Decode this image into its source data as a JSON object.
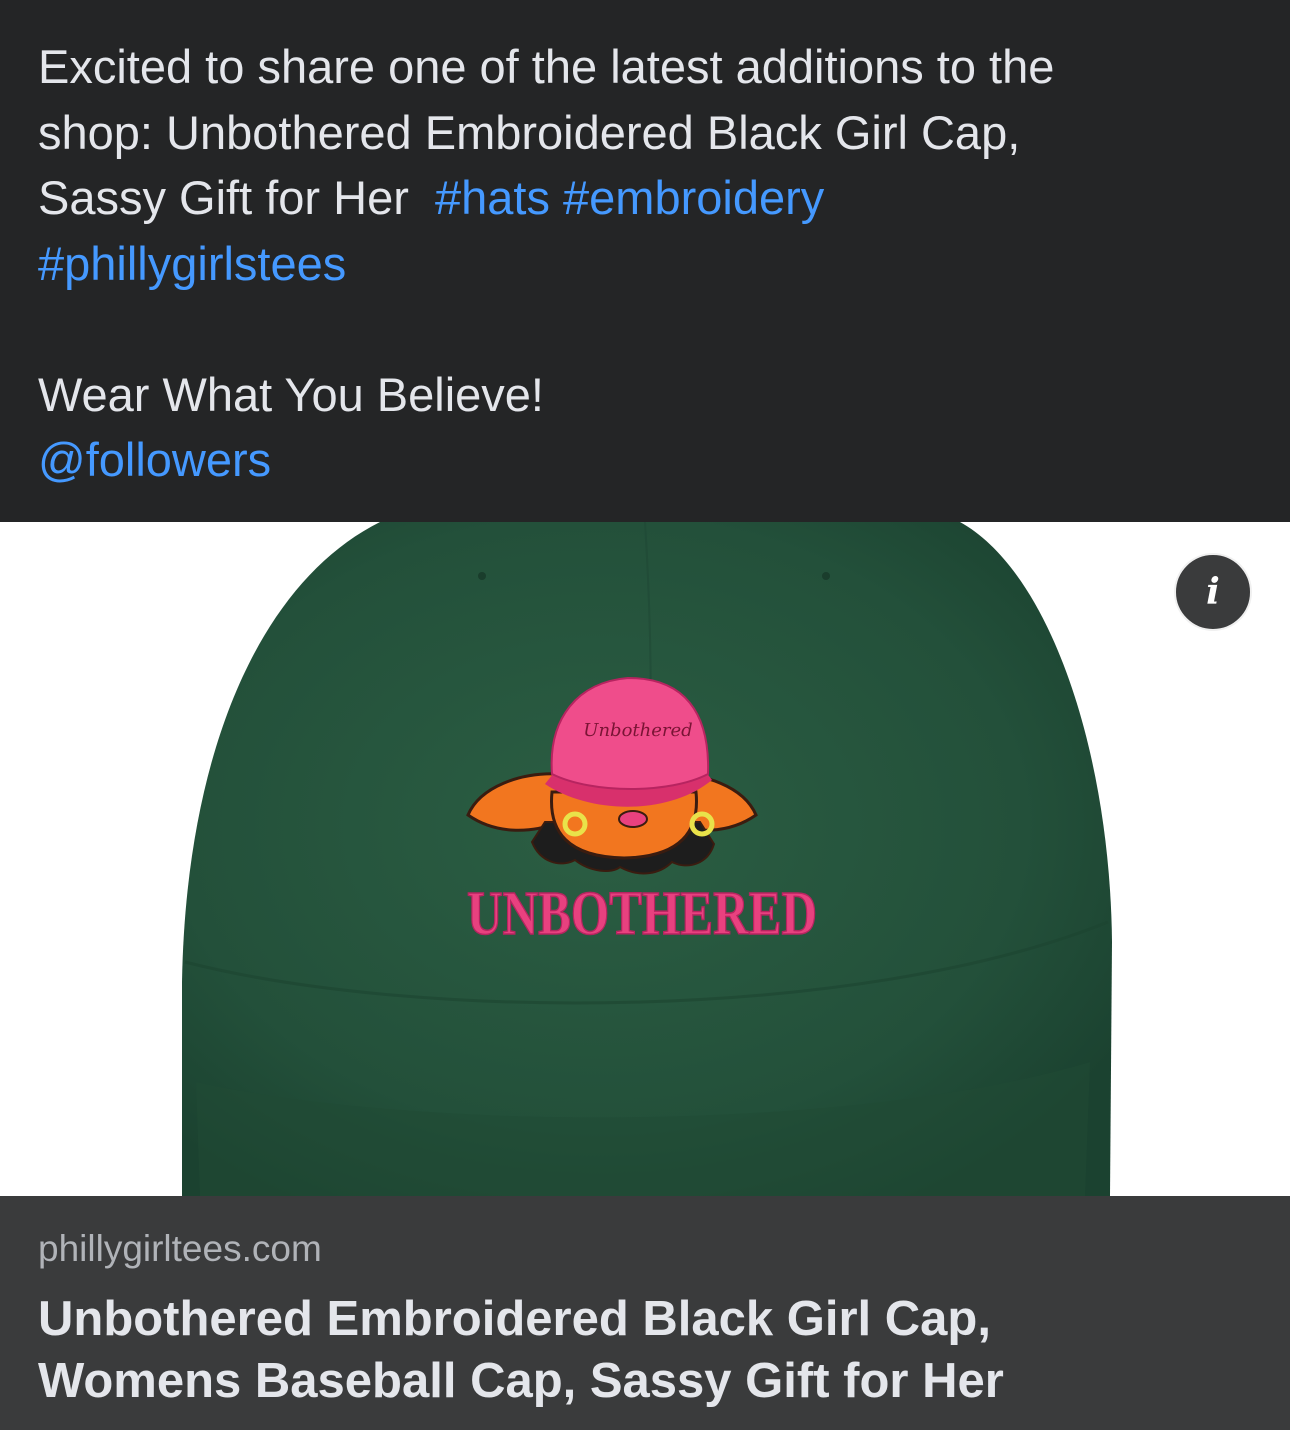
{
  "post": {
    "text_line1": "Excited to share one of the latest additions to the",
    "text_line2": "shop: Unbothered Embroidered Black Girl Cap,",
    "text_line3": "Sassy Gift for Her",
    "hashtags": [
      "#hats",
      "#embroidery",
      "#phillygirlstees"
    ],
    "tagline": "Wear What You Believe!",
    "mention": "@followers"
  },
  "media": {
    "description_icon": "info-icon",
    "embroidery_hat_text": "Unbothered",
    "embroidery_text": "UNBOTHERED",
    "cap_color": "#24513a",
    "embroidery_color": "#e8417f"
  },
  "link_preview": {
    "domain": "phillygirltees.com",
    "title_line1": "Unbothered Embroidered Black Girl Cap,",
    "title_line2": "Womens Baseball Cap, Sassy Gift for Her"
  },
  "colors": {
    "background": "#242526",
    "text": "#e4e6eb",
    "link": "#4599ff",
    "preview_background": "#3a3b3c",
    "secondary_text": "#b0b3b8"
  }
}
